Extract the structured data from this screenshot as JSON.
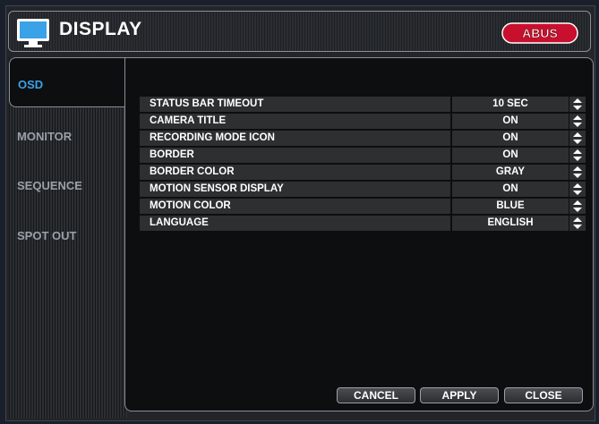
{
  "header": {
    "title": "DISPLAY",
    "icon": "monitor-icon",
    "logo_text": "ABUS"
  },
  "sidebar": {
    "tabs": [
      {
        "label": "OSD",
        "active": true
      },
      {
        "label": "MONITOR",
        "active": false
      },
      {
        "label": "SEQUENCE",
        "active": false
      },
      {
        "label": "SPOT OUT",
        "active": false
      }
    ]
  },
  "settings": [
    {
      "label": "STATUS BAR TIMEOUT",
      "value": "10 SEC"
    },
    {
      "label": "CAMERA TITLE",
      "value": "ON"
    },
    {
      "label": "RECORDING MODE ICON",
      "value": "ON"
    },
    {
      "label": "BORDER",
      "value": "ON"
    },
    {
      "label": "BORDER COLOR",
      "value": "GRAY"
    },
    {
      "label": "MOTION SENSOR DISPLAY",
      "value": "ON"
    },
    {
      "label": "MOTION COLOR",
      "value": "BLUE"
    },
    {
      "label": "LANGUAGE",
      "value": "ENGLISH"
    }
  ],
  "buttons": {
    "cancel": "CANCEL",
    "apply": "APPLY",
    "close": "CLOSE"
  },
  "colors": {
    "accent": "#3aa2e6",
    "logo_red": "#c8102e",
    "row_bg": "#2e2f31"
  }
}
